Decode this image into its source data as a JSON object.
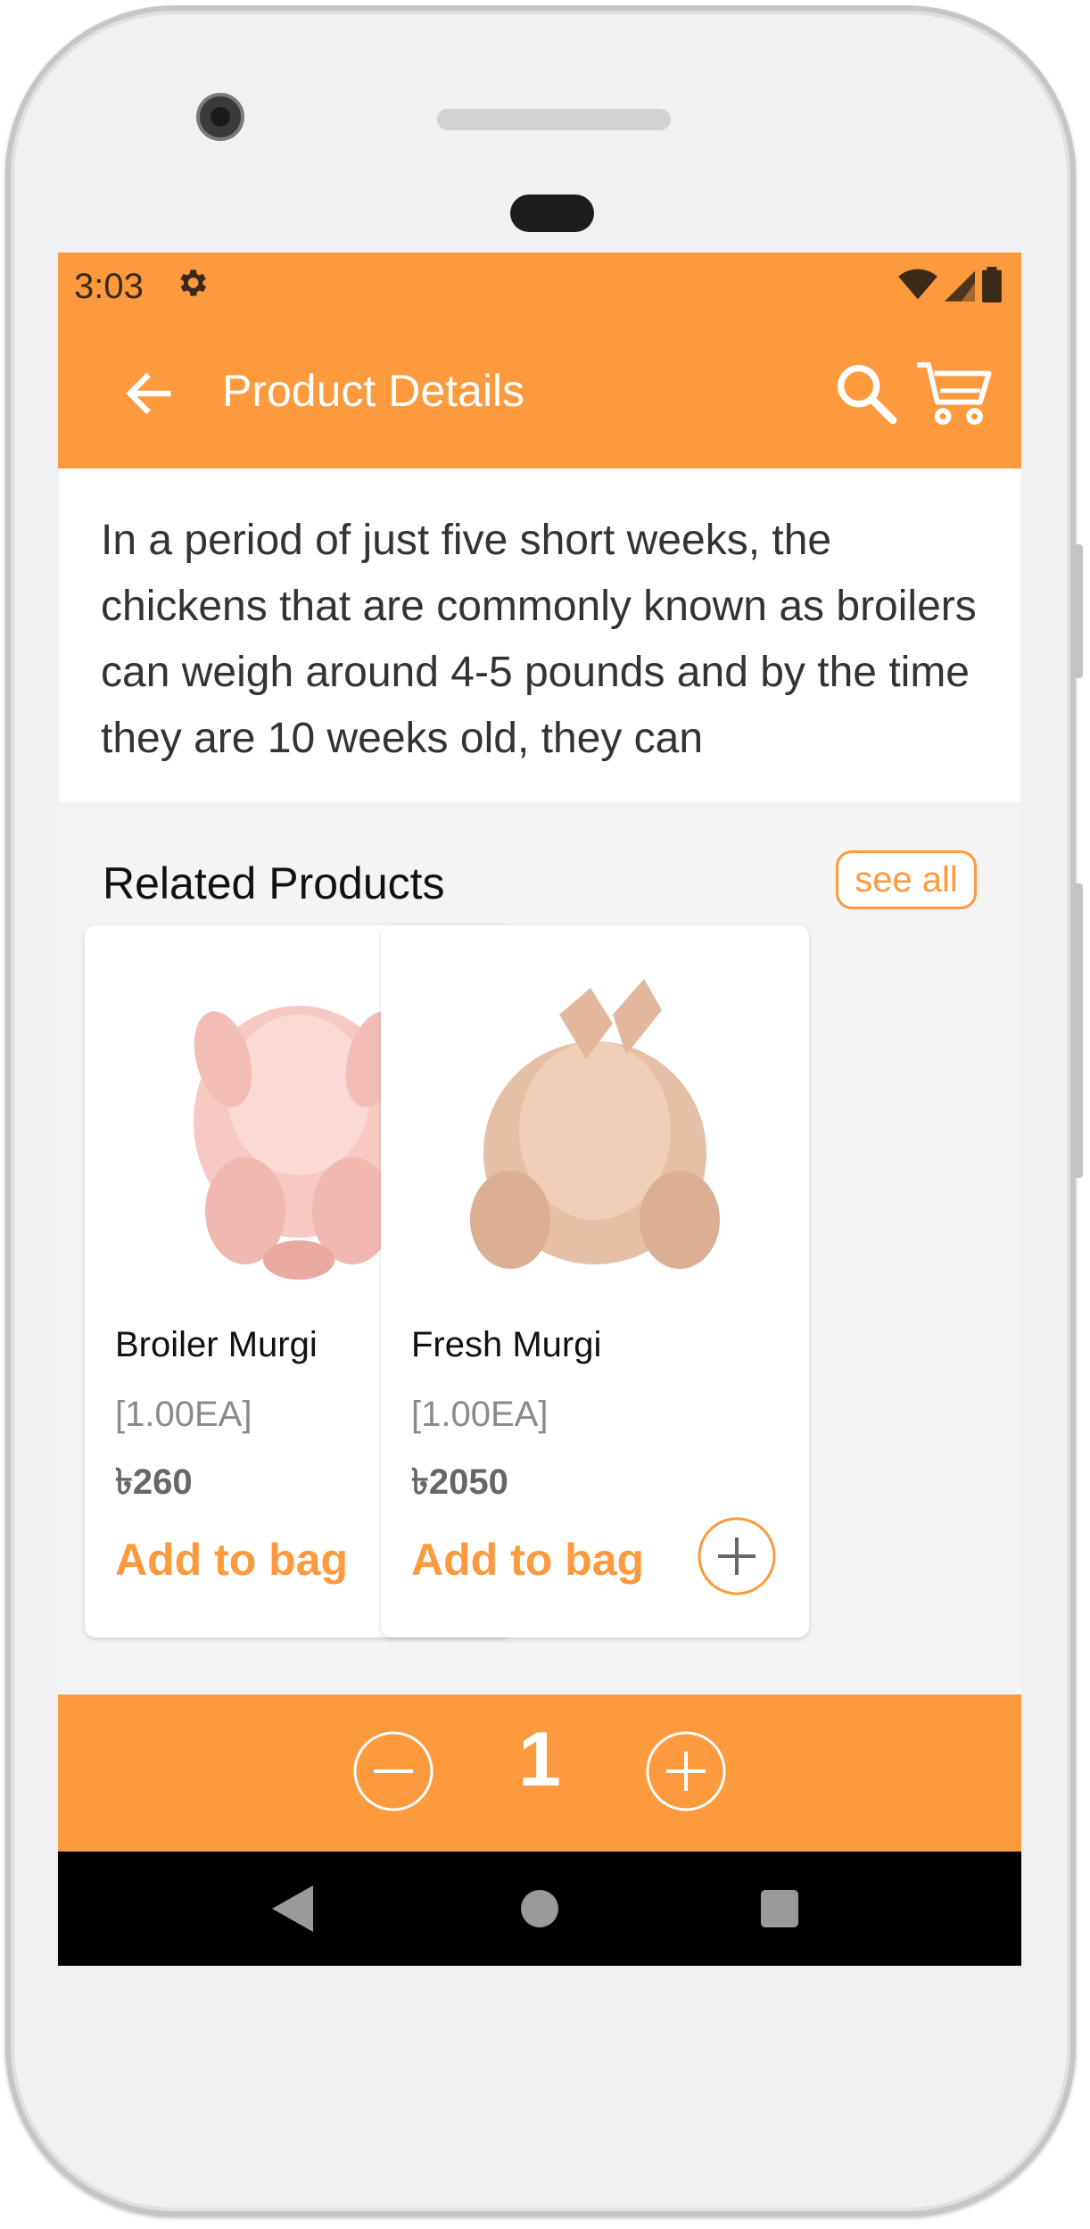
{
  "status_bar": {
    "time": "3:03",
    "icons": [
      "gear-icon",
      "wifi-icon",
      "signal-icon",
      "battery-icon"
    ]
  },
  "app_bar": {
    "title": "Product Details",
    "icons": [
      "back-arrow-icon",
      "search-icon",
      "cart-icon"
    ]
  },
  "description": {
    "text": "In a period of just five short weeks, the chickens that are commonly known as broilers can weigh around 4-5 pounds and by the time they are 10 weeks old, they can"
  },
  "related": {
    "title": "Related Products",
    "see_all_label": "see all",
    "products": [
      {
        "name": "Broiler Murgi",
        "unit": "[1.00EA]",
        "price": "৳260",
        "add_label": "Add to bag"
      },
      {
        "name": "Fresh Murgi",
        "unit": "[1.00EA]",
        "price": "৳2050",
        "add_label": "Add to bag"
      }
    ]
  },
  "quantity_bar": {
    "value": "1",
    "icons": [
      "minus-circle-icon",
      "plus-circle-icon"
    ]
  },
  "colors": {
    "accent": "#fd9a3e",
    "nav_bar": "#000000",
    "background": "#f4f4f4"
  }
}
